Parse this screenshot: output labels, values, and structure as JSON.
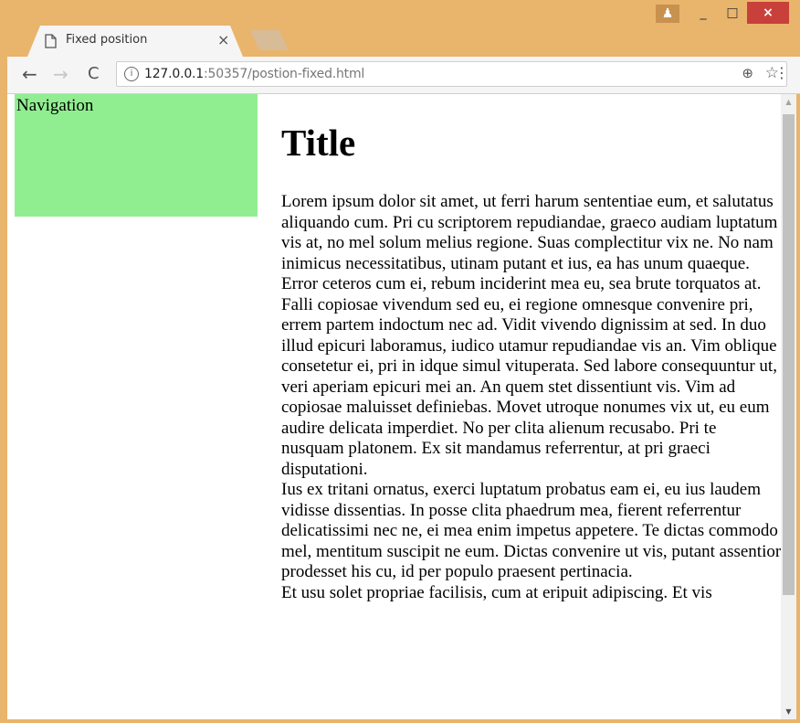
{
  "browser": {
    "tab_title": "Fixed position",
    "tab_close": "×",
    "url_host": "127.0.0.1",
    "url_rest": ":50357/postion-fixed.html",
    "icons": {
      "back": "←",
      "forward": "→",
      "reload": "C",
      "info": "i",
      "zoom": "⊕",
      "star": "☆",
      "menu": "⋮",
      "minimize": "_",
      "maximize": "□",
      "close": "×",
      "user": "♟"
    }
  },
  "page": {
    "nav_label": "Navigation",
    "title": "Title",
    "paragraphs": [
      "Lorem ipsum dolor sit amet, ut ferri harum sententiae eum, et salutatus aliquando cum. Pri cu scriptorem repudiandae, graeco audiam luptatum vis at, no mel solum melius regione. Suas complectitur vix ne. No nam inimicus necessitatibus, utinam putant et ius, ea has unum quaeque. Error ceteros cum ei, rebum inciderint mea eu, sea brute torquatos at.",
      "Falli copiosae vivendum sed eu, ei regione omnesque convenire pri, errem partem indoctum nec ad. Vidit vivendo dignissim at sed. In duo illud epicuri laboramus, iudico utamur repudiandae vis an. Vim oblique consetetur ei, pri in idque simul vituperata. Sed labore consequuntur ut, veri aperiam epicuri mei an. An quem stet dissentiunt vis. Vim ad copiosae maluisset definiebas. Movet utroque nonumes vix ut, eu eum audire delicata imperdiet. No per clita alienum recusabo. Pri te nusquam platonem. Ex sit mandamus referrentur, at pri graeci disputationi.",
      "Ius ex tritani ornatus, exerci luptatum probatus eam ei, eu ius laudem vidisse dissentias. In posse clita phaedrum mea, fierent referrentur delicatissimi nec ne, ei mea enim impetus appetere. Te dictas commodo mel, mentitum suscipit ne eum. Dictas convenire ut vis, putant assentior prodesset his cu, id per populo praesent pertinacia.",
      "Et usu solet propriae facilisis, cum at eripuit adipiscing. Et vis"
    ]
  },
  "colors": {
    "nav_background": "#90ee90",
    "frame": "#e9b46c"
  }
}
